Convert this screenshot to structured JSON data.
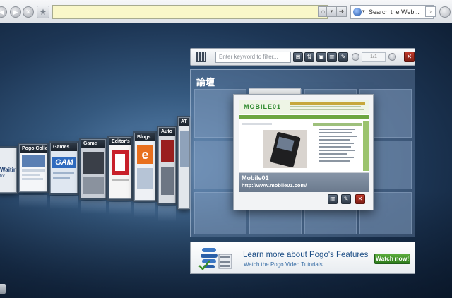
{
  "toolbar": {
    "nav_buttons": [
      {
        "name": "back-icon",
        "glyph": "◀"
      },
      {
        "name": "forward-icon",
        "glyph": "▶"
      },
      {
        "name": "stop-icon",
        "glyph": "✕"
      }
    ],
    "star_icon": "star-icon",
    "address_value": "",
    "search_placeholder": "Search the Web..."
  },
  "carousel": {
    "cards": [
      {
        "label": "Waitin",
        "sublabel": "for"
      },
      {
        "label": "Pogo Collection"
      },
      {
        "label": "Games",
        "logo": "GAM"
      },
      {
        "label": "Game"
      },
      {
        "label": "Editor's P"
      },
      {
        "label": "Blogs",
        "logo": "e"
      },
      {
        "label": "Auto"
      },
      {
        "label": "AT"
      }
    ]
  },
  "panel_toolbar": {
    "filter_placeholder": "Enter keyword to filter...",
    "page_indicator": "1/1"
  },
  "category": {
    "title": "論壇"
  },
  "preview": {
    "site_logo": "MOBILE01",
    "title": "Mobile01",
    "url": "http://www.mobile01.com/"
  },
  "banner": {
    "headline": "Learn more about Pogo's Features",
    "subline": "Watch the Pogo Video Tutorials",
    "button_label": "Watch now!"
  },
  "colors": {
    "accent": "#1e4f86",
    "close": "#c0392b",
    "watch_button": "#3a8f26",
    "address_bar": "#f9f7c9"
  }
}
